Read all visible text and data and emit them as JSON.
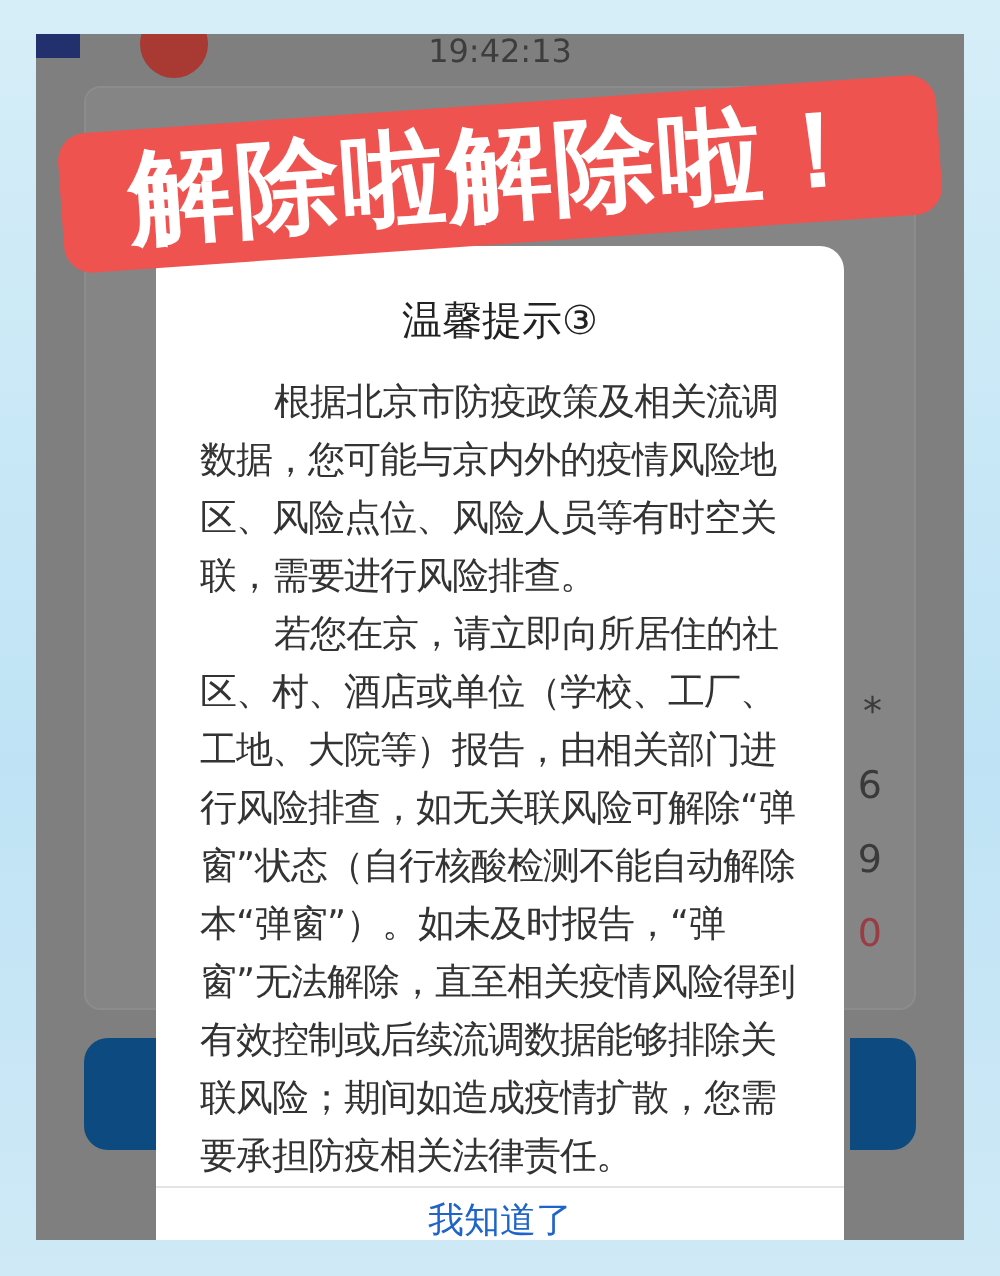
{
  "status": {
    "time": "19:42:13"
  },
  "banner": {
    "text": "解除啦解除啦！"
  },
  "background_card": {
    "values": [
      {
        "text": "*",
        "highlighted": false
      },
      {
        "text": "6",
        "highlighted": false
      },
      {
        "text": "9",
        "highlighted": false
      },
      {
        "text": "0",
        "highlighted": true
      }
    ]
  },
  "dialog": {
    "title": "温馨提示③",
    "paragraphs": [
      "根据北京市防疫政策及相关流调数据，您可能与京内外的疫情风险地区、风险点位、风险人员等有时空关联，需要进行风险排查。",
      "若您在京，请立即向所居住的社区、村、酒店或单位（学校、工厂、工地、大院等）报告，由相关部门进行风险排查，如无关联风险可解除“弹窗”状态（自行核酸检测不能自动解除本“弹窗”）。如未及时报告，“弹窗”无法解除，直至相关疫情风险得到有效控制或后续流调数据能够排除关联风险；期间如造成疫情扩散，您需要承担防疫相关法律责任。"
    ],
    "button": "我知道了"
  }
}
